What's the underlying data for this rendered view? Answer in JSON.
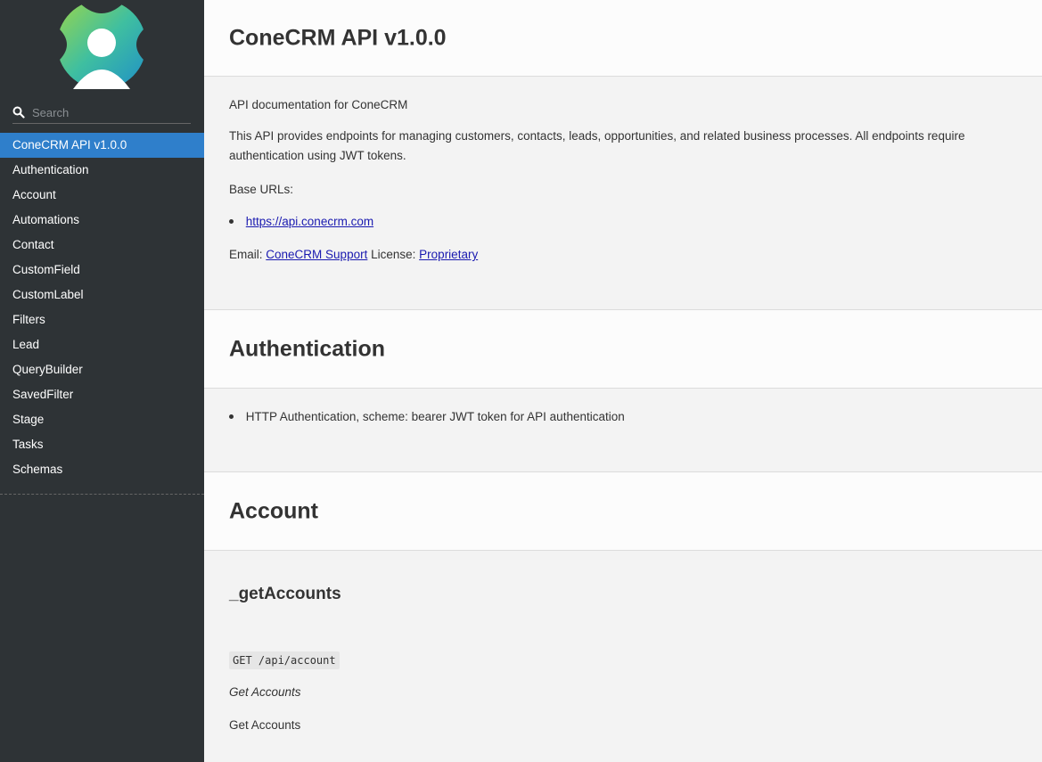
{
  "sidebar": {
    "search_placeholder": "Search",
    "items": [
      {
        "label": "ConeCRM API v1.0.0",
        "active": true
      },
      {
        "label": "Authentication"
      },
      {
        "label": "Account"
      },
      {
        "label": "Automations"
      },
      {
        "label": "Contact"
      },
      {
        "label": "CustomField"
      },
      {
        "label": "CustomLabel"
      },
      {
        "label": "Filters"
      },
      {
        "label": "Lead"
      },
      {
        "label": "QueryBuilder"
      },
      {
        "label": "SavedFilter"
      },
      {
        "label": "Stage"
      },
      {
        "label": "Tasks"
      },
      {
        "label": "Schemas"
      }
    ]
  },
  "intro": {
    "title": "ConeCRM API v1.0.0",
    "summary": "API documentation for ConeCRM",
    "description": "This API provides endpoints for managing customers, contacts, leads, opportunities, and related business processes. All endpoints require authentication using JWT tokens.",
    "base_urls_label": "Base URLs:",
    "base_url": "https://api.conecrm.com",
    "email_label": "Email:",
    "email_link": "ConeCRM Support",
    "license_label": "License:",
    "license_link": "Proprietary"
  },
  "auth": {
    "title": "Authentication",
    "item": "HTTP Authentication, scheme: bearer JWT token for API authentication"
  },
  "account": {
    "title": "Account",
    "op_title": "_getAccounts",
    "endpoint": "GET /api/account",
    "summary": "Get Accounts",
    "description": "Get Accounts"
  },
  "colors": {
    "sidebar_bg": "#2e3336",
    "active_bg": "#2f7fcb",
    "link": "#1a1ab0"
  }
}
